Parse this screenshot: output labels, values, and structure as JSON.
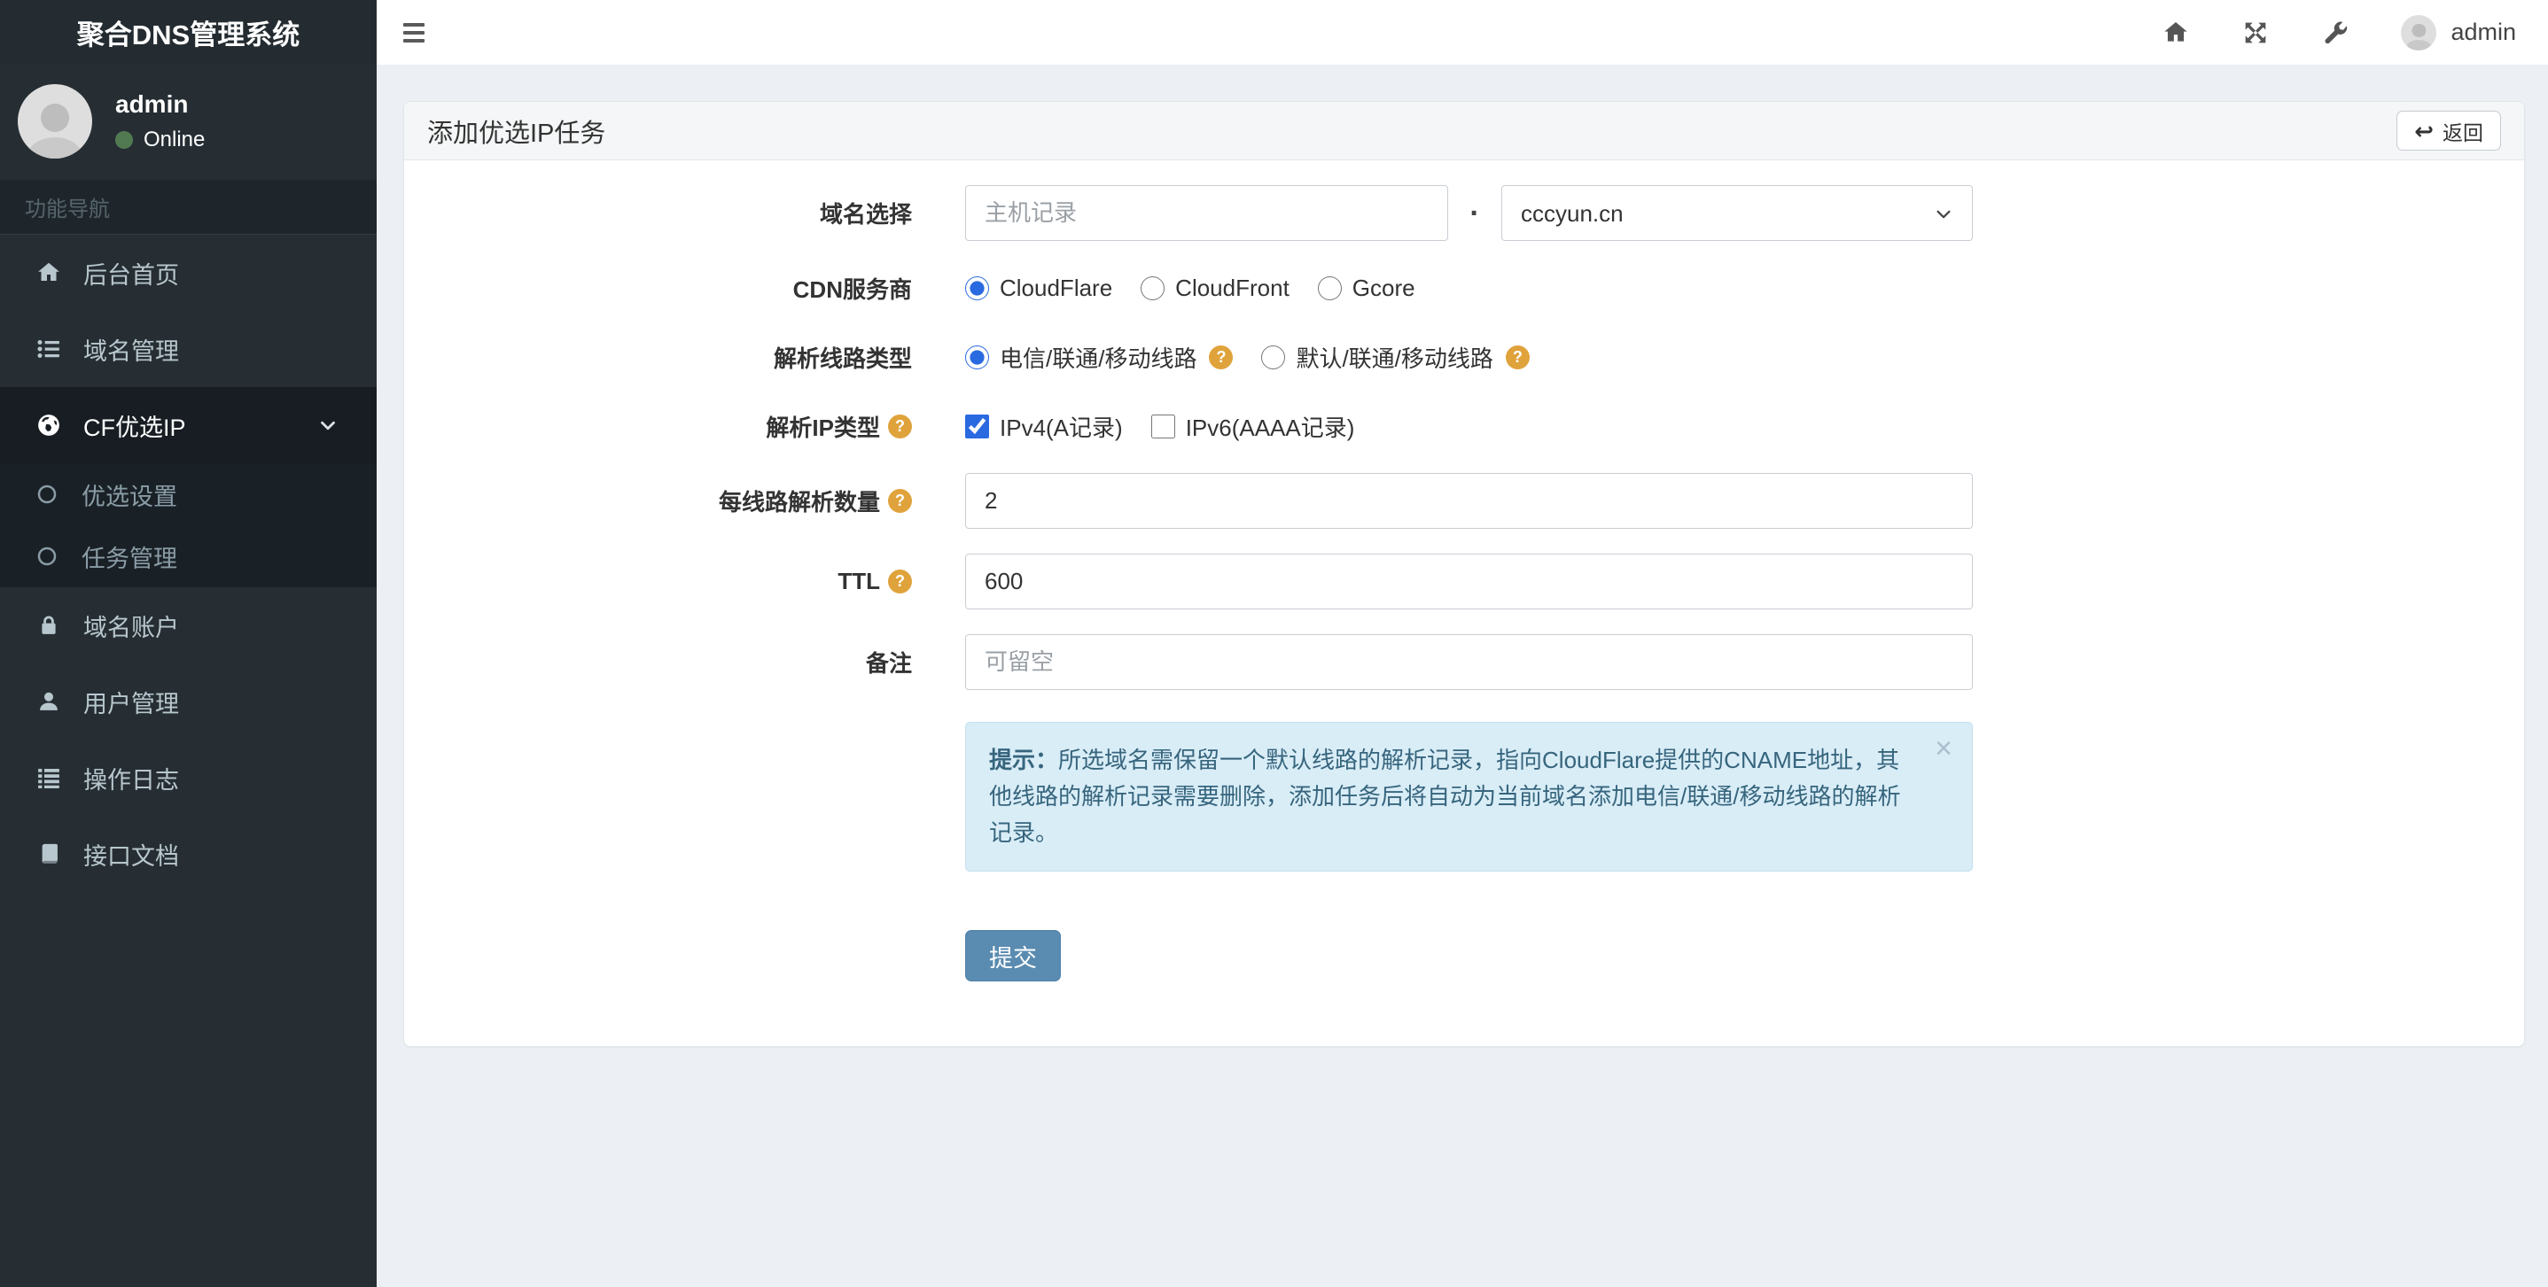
{
  "app": {
    "logo_title": "聚合DNS管理系统"
  },
  "topbar": {
    "admin_label": "admin"
  },
  "sidebar": {
    "user_name": "admin",
    "user_status": "Online",
    "section_header": "功能导航",
    "items": [
      {
        "label": "后台首页",
        "icon": "home-icon"
      },
      {
        "label": "域名管理",
        "icon": "list-icon"
      },
      {
        "label": "CF优选IP",
        "icon": "globe-icon"
      },
      {
        "label": "优选设置",
        "icon": "circle-icon"
      },
      {
        "label": "任务管理",
        "icon": "circle-icon"
      },
      {
        "label": "域名账户",
        "icon": "lock-icon"
      },
      {
        "label": "用户管理",
        "icon": "user-icon"
      },
      {
        "label": "操作日志",
        "icon": "list-icon"
      },
      {
        "label": "接口文档",
        "icon": "book-icon"
      }
    ]
  },
  "panel": {
    "title": "添加优选IP任务",
    "back_label": "返回",
    "back_icon": "↩"
  },
  "form": {
    "domain_row": {
      "label": "域名选择",
      "host_placeholder": "主机记录",
      "separator": "·",
      "domain_selected": "cccyun.cn"
    },
    "cdn_row": {
      "label": "CDN服务商",
      "options": [
        "CloudFlare",
        "CloudFront",
        "Gcore"
      ],
      "selected": "CloudFlare"
    },
    "line_row": {
      "label": "解析线路类型",
      "options": [
        "电信/联通/移动线路",
        "默认/联通/移动线路"
      ],
      "selected": "电信/联通/移动线路"
    },
    "iptype_row": {
      "label": "解析IP类型",
      "options": [
        "IPv4(A记录)",
        "IPv6(AAAA记录)"
      ],
      "checked": [
        "IPv4(A记录)"
      ]
    },
    "count_row": {
      "label": "每线路解析数量",
      "value": "2"
    },
    "ttl_row": {
      "label": "TTL",
      "value": "600"
    },
    "remark_row": {
      "label": "备注",
      "placeholder": "可留空"
    },
    "tip": {
      "prefix": "提示：",
      "text": "所选域名需保留一个默认线路的解析记录，指向CloudFlare提供的CNAME地址，其他线路的解析记录需要删除，添加任务后将自动为当前域名添加电信/联通/移动线路的解析记录。",
      "close_label": "×"
    },
    "submit_label": "提交"
  },
  "colors": {
    "sidebar_bg": "#262e33",
    "accent_blue": "#2a6ae0",
    "submit_blue": "#5a8bb0",
    "alert_bg": "#d9edf7",
    "alert_text": "#36657d",
    "question_orange": "#e0a33c",
    "online_green": "#527a52"
  }
}
